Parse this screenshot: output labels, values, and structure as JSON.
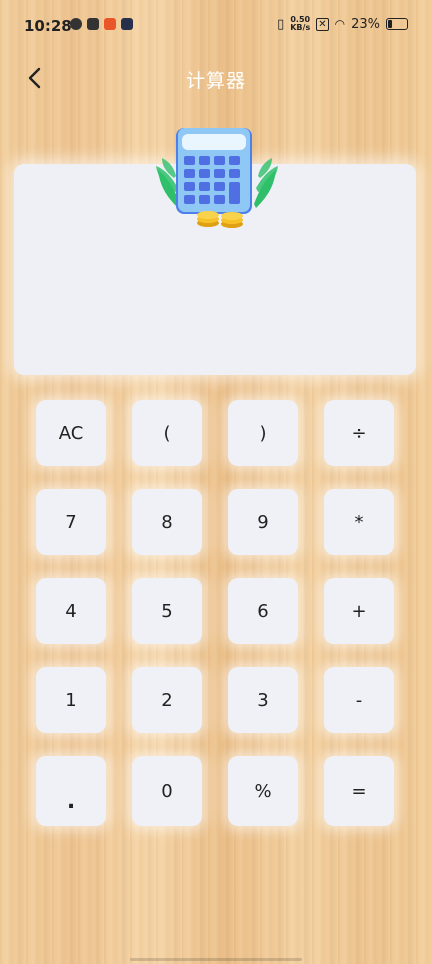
{
  "status_bar": {
    "time": "10:28",
    "net_speed_value": "0.50",
    "net_speed_unit": "KB/s",
    "battery": "23%"
  },
  "header": {
    "title": "计算器"
  },
  "keypad": {
    "rows": [
      [
        "AC",
        "(",
        ")",
        "÷"
      ],
      [
        "7",
        "8",
        "9",
        "*"
      ],
      [
        "4",
        "5",
        "6",
        "+"
      ],
      [
        "1",
        "2",
        "3",
        "-"
      ],
      [
        ".",
        "0",
        "%",
        "="
      ]
    ]
  },
  "colors": {
    "title_text": "#ffffff",
    "key_bg": "#f0f1f6",
    "display_bg": "#eff0f5",
    "calc_body": "#8fc7f5",
    "calc_keys": "#4f6fe3",
    "leaf": "#2fbf6a",
    "coin": "#f6c228"
  },
  "icons": [
    "back-arrow-icon",
    "calculator-illustration"
  ]
}
